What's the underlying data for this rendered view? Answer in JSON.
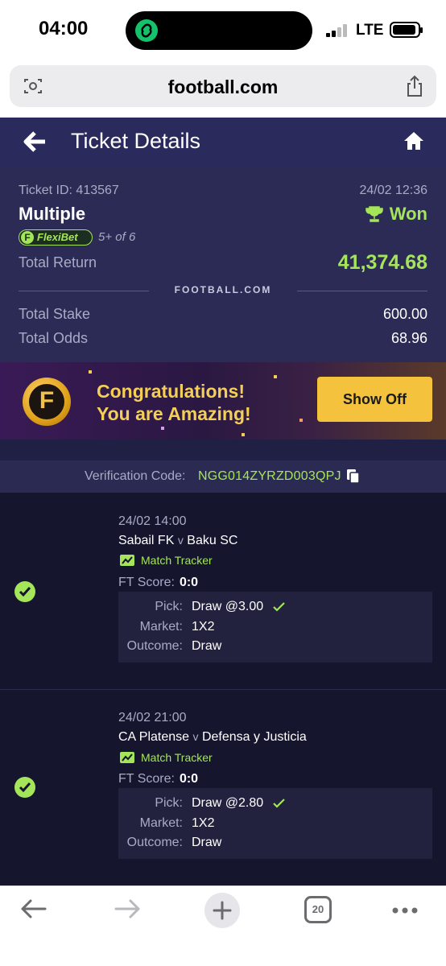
{
  "status_bar": {
    "time": "04:00",
    "network": "LTE"
  },
  "browser": {
    "url": "football.com",
    "tab_count": "20"
  },
  "header": {
    "title": "Ticket Details"
  },
  "ticket": {
    "id_label": "Ticket ID: 413567",
    "datetime": "24/02 12:36",
    "type": "Multiple",
    "status": "Won",
    "flexibet_label": "FlexiBet",
    "flexibet_count": "5+ of 6",
    "total_return_label": "Total Return",
    "total_return": "41,374.68",
    "brand": "FOOTBALL.COM",
    "total_stake_label": "Total Stake",
    "total_stake": "600.00",
    "total_odds_label": "Total Odds",
    "total_odds": "68.96"
  },
  "banner": {
    "logo_letter": "F",
    "line1": "Congratulations!",
    "line2": "You are Amazing!",
    "button": "Show Off"
  },
  "verification": {
    "label": "Verification Code:",
    "code": "NGG014ZYRZD003QPJ"
  },
  "selections": [
    {
      "datetime": "24/02 14:00",
      "home": "Sabail FK",
      "vs": "v",
      "away": "Baku SC",
      "tracker": "Match Tracker",
      "ft_label": "FT Score:",
      "ft_score": "0:0",
      "pick_label": "Pick:",
      "pick": "Draw @3.00",
      "market_label": "Market:",
      "market": "1X2",
      "outcome_label": "Outcome:",
      "outcome": "Draw"
    },
    {
      "datetime": "24/02 21:00",
      "home": "CA Platense",
      "vs": "v",
      "away": "Defensa y Justicia",
      "tracker": "Match Tracker",
      "ft_label": "FT Score:",
      "ft_score": "0:0",
      "pick_label": "Pick:",
      "pick": "Draw @2.80",
      "market_label": "Market:",
      "market": "1X2",
      "outcome_label": "Outcome:",
      "outcome": "Draw"
    }
  ],
  "colors": {
    "accent_green": "#a4e55a",
    "header_bg": "#2a2a5c",
    "button_yellow": "#f4c23d"
  }
}
